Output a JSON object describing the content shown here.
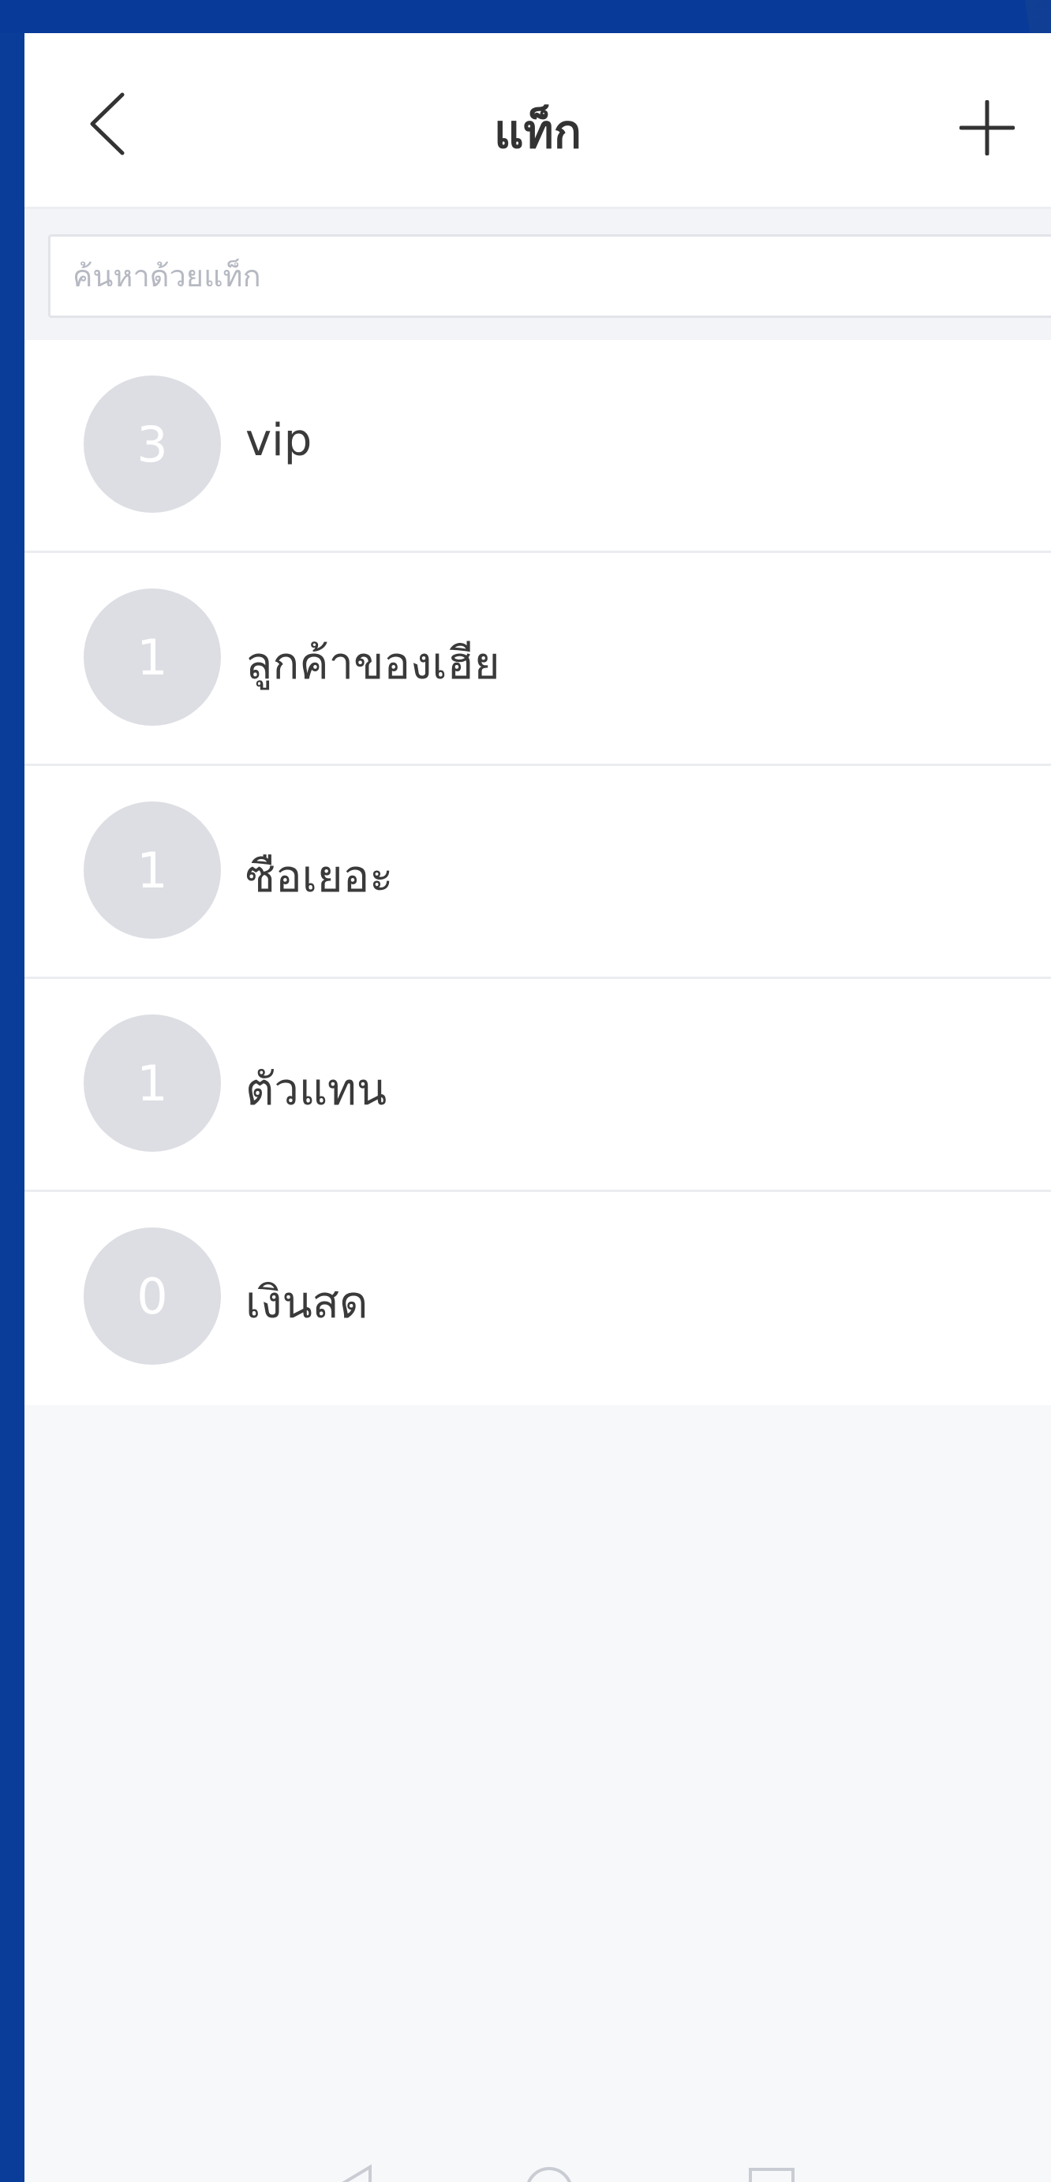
{
  "header": {
    "title": "แท็ก"
  },
  "search": {
    "placeholder": "ค้นหาด้วยแท็ก",
    "value": ""
  },
  "tags": [
    {
      "count": "3",
      "label": "vip"
    },
    {
      "count": "1",
      "label": "ลูกค้าของเฮีย"
    },
    {
      "count": "1",
      "label": "ซือเยอะ"
    },
    {
      "count": "1",
      "label": "ตัวแทน"
    },
    {
      "count": "0",
      "label": "เงินสด"
    }
  ],
  "icons": {
    "back": "chevron-left-icon",
    "add": "plus-icon"
  },
  "colors": {
    "frame": "#0a3d9a",
    "badge": "#dcdee3",
    "background": "#f7f8fa"
  }
}
